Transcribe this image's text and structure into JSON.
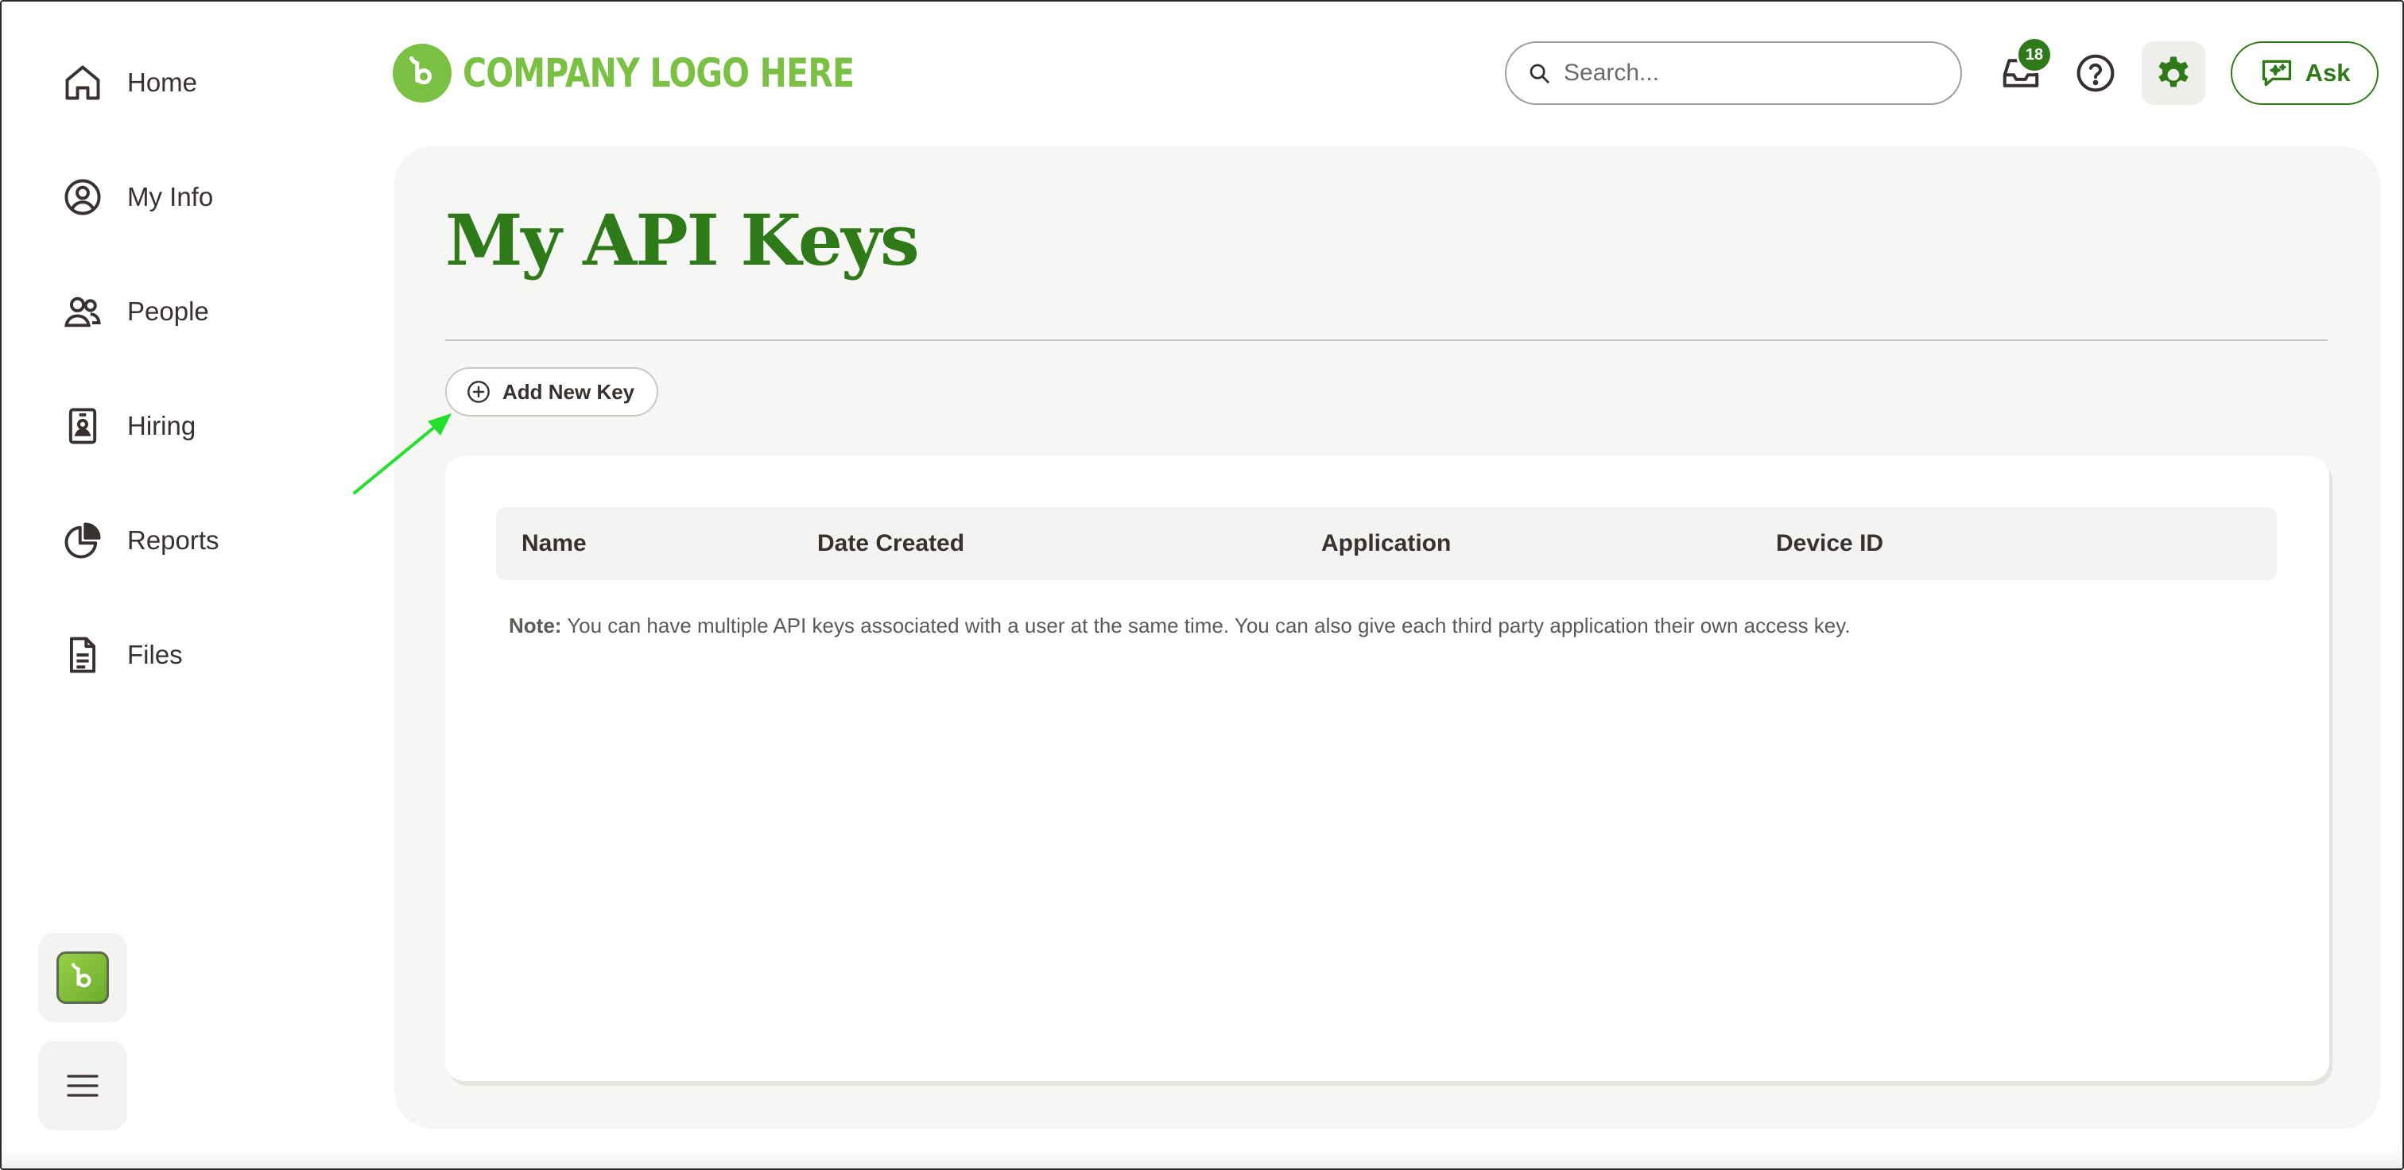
{
  "sidebar": {
    "items": [
      {
        "label": "Home",
        "icon": "home-icon"
      },
      {
        "label": "My Info",
        "icon": "user-circle-icon"
      },
      {
        "label": "People",
        "icon": "people-icon"
      },
      {
        "label": "Hiring",
        "icon": "id-badge-icon"
      },
      {
        "label": "Reports",
        "icon": "pie-chart-icon"
      },
      {
        "label": "Files",
        "icon": "file-icon"
      }
    ],
    "app_icon": "app-logo-icon",
    "menu_icon": "hamburger-menu-icon"
  },
  "header": {
    "logo_text": "COMPANY LOGO HERE",
    "search_placeholder": "Search...",
    "inbox_badge": "18",
    "ask_label": "Ask"
  },
  "main": {
    "title": "My API Keys",
    "add_key_label": "Add New Key",
    "table": {
      "columns": [
        "Name",
        "Date Created",
        "Application",
        "Device ID"
      ]
    },
    "note_label": "Note:",
    "note_text": " You can have multiple API keys associated with a user at the same time. You can also give each third party application their own access key."
  },
  "colors": {
    "brand_green": "#2e7918",
    "logo_green": "#7ac143",
    "panel_bg": "#f6f6f4",
    "text": "#38312f",
    "annotation_arrow": "#22e12a"
  }
}
